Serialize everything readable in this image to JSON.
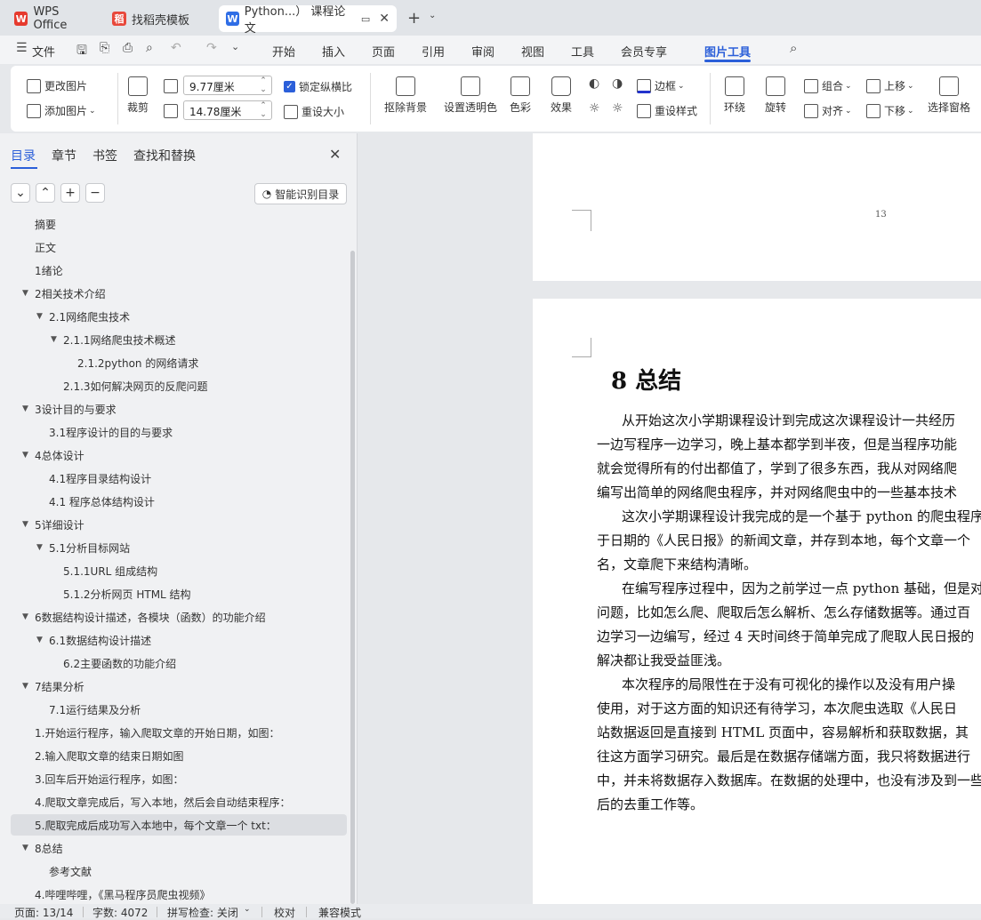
{
  "tabs": [
    {
      "label": "WPS Office"
    },
    {
      "label": "找稻壳模板"
    },
    {
      "label": "Python...）  课程论文"
    }
  ],
  "menubar": {
    "file": "文件",
    "items": [
      "开始",
      "插入",
      "页面",
      "引用",
      "审阅",
      "视图",
      "工具",
      "会员专享",
      "图片工具"
    ],
    "active": "图片工具"
  },
  "ribbon": {
    "change_image": "更改图片",
    "add_image": "添加图片",
    "crop": "裁剪",
    "width": "9.77厘米",
    "height": "14.78厘米",
    "lock_ratio": "锁定纵横比",
    "reset_size": "重设大小",
    "remove_bg": "抠除背景",
    "set_transparent": "设置透明色",
    "color": "色彩",
    "effect": "效果",
    "border": "边框",
    "reset_style": "重设样式",
    "wrap": "环绕",
    "rotate": "旋转",
    "group": "组合",
    "align": "对齐",
    "move_up": "上移",
    "move_down": "下移",
    "select_pane": "选择窗格"
  },
  "sidebar": {
    "tabs": [
      "目录",
      "章节",
      "书签",
      "查找和替换"
    ],
    "smart_toc": "智能识别目录",
    "toc": [
      {
        "label": "摘要",
        "level": 0,
        "expand": false
      },
      {
        "label": "正文",
        "level": 0,
        "expand": false
      },
      {
        "label": "1绪论",
        "level": 0,
        "expand": false
      },
      {
        "label": "2相关技术介绍",
        "level": 0,
        "expand": true
      },
      {
        "label": "2.1网络爬虫技术",
        "level": 1,
        "expand": true
      },
      {
        "label": "2.1.1网络爬虫技术概述",
        "level": 2,
        "expand": true
      },
      {
        "label": "2.1.2python 的网络请求",
        "level": 3,
        "expand": false
      },
      {
        "label": "2.1.3如何解决网页的反爬问题",
        "level": 2,
        "expand": false
      },
      {
        "label": "3设计目的与要求",
        "level": 0,
        "expand": true
      },
      {
        "label": "3.1程序设计的目的与要求",
        "level": 1,
        "expand": false
      },
      {
        "label": "4总体设计",
        "level": 0,
        "expand": true
      },
      {
        "label": "4.1程序目录结构设计",
        "level": 1,
        "expand": false
      },
      {
        "label": "4.1 程序总体结构设计",
        "level": 1,
        "expand": false
      },
      {
        "label": "5详细设计",
        "level": 0,
        "expand": true
      },
      {
        "label": "5.1分析目标网站",
        "level": 1,
        "expand": true
      },
      {
        "label": "5.1.1URL 组成结构",
        "level": 2,
        "expand": false
      },
      {
        "label": "5.1.2分析网页 HTML 结构",
        "level": 2,
        "expand": false
      },
      {
        "label": "6数据结构设计描述，各模块（函数）的功能介绍",
        "level": 0,
        "expand": true
      },
      {
        "label": "6.1数据结构设计描述",
        "level": 1,
        "expand": true
      },
      {
        "label": "6.2主要函数的功能介绍",
        "level": 2,
        "expand": false
      },
      {
        "label": "7结果分析",
        "level": 0,
        "expand": true
      },
      {
        "label": "7.1运行结果及分析",
        "level": 1,
        "expand": false
      },
      {
        "label": "1.开始运行程序，输入爬取文章的开始日期，如图：",
        "level": 0,
        "expand": false
      },
      {
        "label": "2.输入爬取文章的结束日期如图",
        "level": 0,
        "expand": false
      },
      {
        "label": "3.回车后开始运行程序，如图：",
        "level": 0,
        "expand": false
      },
      {
        "label": "4.爬取文章完成后，写入本地，然后会自动结束程序：",
        "level": 0,
        "expand": false
      },
      {
        "label": "5.爬取完成后成功写入本地中，每个文章一个 txt：",
        "level": 0,
        "expand": false,
        "selected": true
      },
      {
        "label": "8总结",
        "level": 0,
        "expand": true
      },
      {
        "label": "参考文献",
        "level": 1,
        "expand": false
      },
      {
        "label": "4.哔哩哔哩，《黑马程序员爬虫视频》",
        "level": 0,
        "expand": false
      }
    ]
  },
  "document": {
    "page_number": "13",
    "heading": "8 总结",
    "lines": [
      "从开始这次小学期课程设计到完成这次课程设计一共经历",
      "一边写程序一边学习，晚上基本都学到半夜，但是当程序功能",
      "就会觉得所有的付出都值了，学到了很多东西，我从对网络爬",
      "编写出简单的网络爬虫程序，并对网络爬虫中的一些基本技术",
      "这次小学期课程设计我完成的是一个基于 python 的爬虫程序",
      "于日期的《人民日报》的新闻文章，并存到本地，每个文章一个",
      "名，文章爬下来结构清晰。",
      "在编写程序过程中，因为之前学过一点 python 基础，但是对",
      "问题，比如怎么爬、爬取后怎么解析、怎么存储数据等。通过百",
      "边学习一边编写，经过 4 天时间终于简单完成了爬取人民日报的",
      "解决都让我受益匪浅。",
      "本次程序的局限性在于没有可视化的操作以及没有用户操",
      "使用，对于这方面的知识还有待学习，本次爬虫选取《人民日",
      "站数据返回是直接到 HTML 页面中，容易解析和获取数据，其",
      "往这方面学习研究。最后是在数据存储端方面，我只将数据进行",
      "中，并未将数据存入数据库。在数据的处理中，也没有涉及到一些",
      "后的去重工作等。"
    ],
    "indent": [
      true,
      false,
      false,
      false,
      true,
      false,
      false,
      true,
      false,
      false,
      false,
      true,
      false,
      false,
      false,
      false,
      false
    ]
  },
  "status": {
    "page": "页面: 13/14",
    "words": "字数: 4072",
    "spell": "拼写检查: 关闭",
    "proof": "校对",
    "compat": "兼容模式"
  }
}
